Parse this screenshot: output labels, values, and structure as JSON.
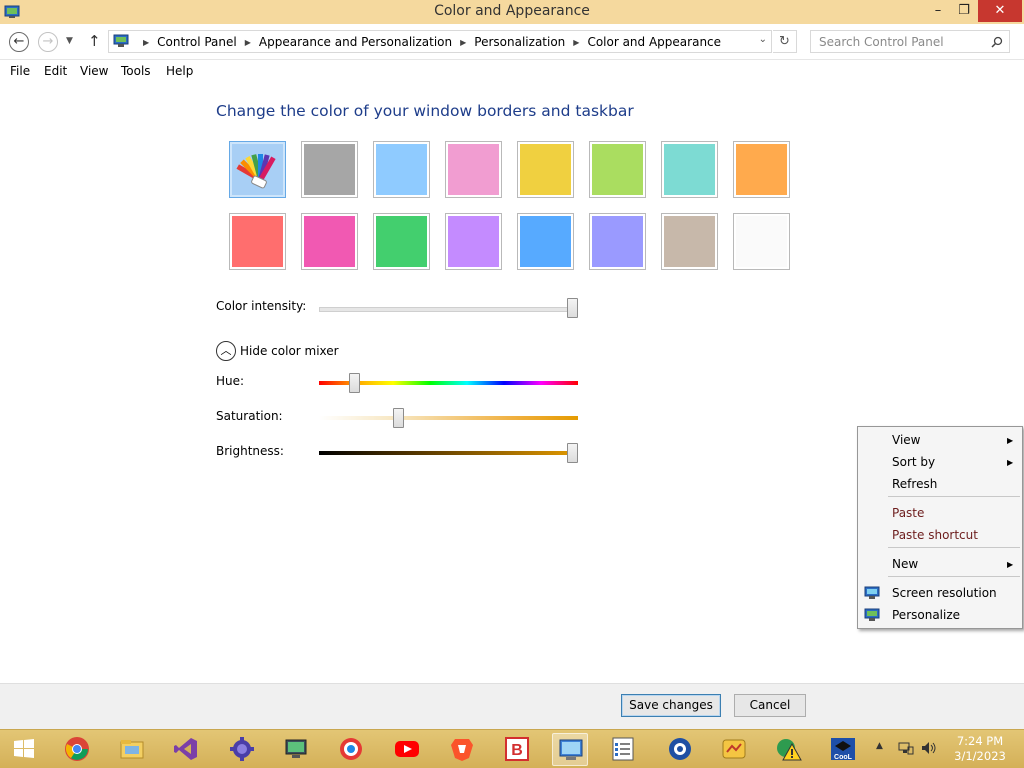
{
  "window": {
    "title": "Color and Appearance",
    "controls": {
      "minimize": "–",
      "maximize": "❐",
      "close": "✕"
    }
  },
  "address": {
    "crumbs": [
      "Control Panel",
      "Appearance and Personalization",
      "Personalization",
      "Color and Appearance"
    ],
    "search_placeholder": "Search Control Panel"
  },
  "menu": [
    "File",
    "Edit",
    "View",
    "Tools",
    "Help"
  ],
  "content": {
    "heading": "Change the color of your window borders and taskbar",
    "swatches": [
      {
        "name": "automatic",
        "color": "#a8cff5",
        "selected": true
      },
      {
        "name": "gray",
        "color": "#a6a6a6"
      },
      {
        "name": "sky",
        "color": "#8fcbff"
      },
      {
        "name": "pink",
        "color": "#f19dd1"
      },
      {
        "name": "yellow",
        "color": "#f0d040"
      },
      {
        "name": "lime",
        "color": "#aadd60"
      },
      {
        "name": "teal",
        "color": "#7ddbd3"
      },
      {
        "name": "orange",
        "color": "#ffaa4d"
      },
      {
        "name": "red",
        "color": "#ff6e6e"
      },
      {
        "name": "magenta",
        "color": "#f159b2"
      },
      {
        "name": "green",
        "color": "#43cf6e"
      },
      {
        "name": "purple",
        "color": "#c48bff"
      },
      {
        "name": "blue",
        "color": "#57aaff"
      },
      {
        "name": "periwinkle",
        "color": "#9a9aff"
      },
      {
        "name": "taupe",
        "color": "#c7b8aa"
      },
      {
        "name": "white",
        "color": "#fafafa"
      }
    ],
    "color_intensity_label": "Color intensity:",
    "color_intensity_level": 1.0,
    "mixer_toggle_label": "Hide color mixer",
    "hue_label": "Hue:",
    "hue_level": 0.12,
    "saturation_label": "Saturation:",
    "saturation_level": 0.3,
    "brightness_label": "Brightness:",
    "brightness_level": 1.0
  },
  "footer": {
    "save_label": "Save changes",
    "cancel_label": "Cancel"
  },
  "context_menu": {
    "view": "View",
    "sort_by": "Sort by",
    "refresh": "Refresh",
    "paste": "Paste",
    "paste_shortcut": "Paste shortcut",
    "new": "New",
    "screen_resolution": "Screen resolution",
    "personalize": "Personalize"
  },
  "taskbar": {
    "apps": [
      "start",
      "chrome",
      "file-explorer",
      "visual-studio",
      "settings-gear",
      "computer-monitor",
      "browser",
      "youtube",
      "brave",
      "bitdefender",
      "control-panel",
      "task-list",
      "network-tool",
      "notes",
      "warning-app",
      "cooler-app"
    ],
    "time": "7:24 PM",
    "date": "3/1/2023"
  }
}
